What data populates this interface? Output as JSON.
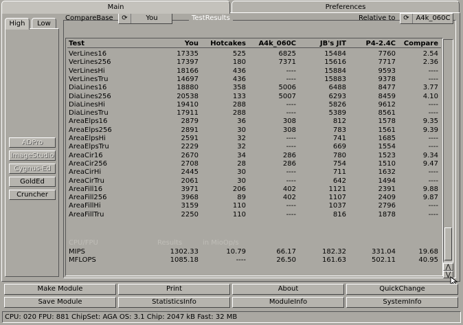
{
  "tabs": {
    "main": "Main",
    "preferences": "Preferences"
  },
  "subtabs": {
    "high": "High",
    "low": "Low"
  },
  "sidebar": {
    "buttons": [
      {
        "label": "ADPro",
        "enabled": false
      },
      {
        "label": "ImageStudio",
        "enabled": false
      },
      {
        "label": "Cygnus-Ed",
        "enabled": false
      },
      {
        "label": "GoldEd",
        "enabled": true
      },
      {
        "label": "Cruncher",
        "enabled": true
      }
    ]
  },
  "results": {
    "group_title": "TestResults",
    "compare_base_label": "CompareBase",
    "compare_base_value": "You",
    "relative_to_label": "Relative to",
    "relative_to_value": "A4k_060C",
    "headers": [
      "Test",
      "You",
      "Hotcakes",
      "A4k_060C",
      "JB's JIT",
      "P4-2.4C",
      "Compare"
    ],
    "rows": [
      [
        "VerLines16",
        "17335",
        "525",
        "6825",
        "15484",
        "7760",
        "2.54"
      ],
      [
        "VerLines256",
        "17397",
        "180",
        "7371",
        "15616",
        "7717",
        "2.36"
      ],
      [
        "VerLinesHi",
        "18166",
        "436",
        "----",
        "15884",
        "9593",
        "----"
      ],
      [
        "VerLinesTru",
        "14697",
        "436",
        "----",
        "15883",
        "9378",
        "----"
      ],
      [
        "DiaLines16",
        "18880",
        "358",
        "5006",
        "6488",
        "8477",
        "3.77"
      ],
      [
        "DiaLines256",
        "20538",
        "133",
        "5007",
        "6293",
        "8459",
        "4.10"
      ],
      [
        "DiaLinesHi",
        "19410",
        "288",
        "----",
        "5826",
        "9612",
        "----"
      ],
      [
        "DiaLinesTru",
        "17911",
        "288",
        "----",
        "5389",
        "8561",
        "----"
      ],
      [
        "AreaElps16",
        "2879",
        "36",
        "308",
        "812",
        "1578",
        "9.35"
      ],
      [
        "AreaElps256",
        "2891",
        "30",
        "308",
        "783",
        "1561",
        "9.39"
      ],
      [
        "AreaElpsHi",
        "2591",
        "32",
        "----",
        "741",
        "1685",
        "----"
      ],
      [
        "AreaElpsTru",
        "2229",
        "32",
        "----",
        "669",
        "1554",
        "----"
      ],
      [
        "AreaCir16",
        "2670",
        "34",
        "286",
        "780",
        "1523",
        "9.34"
      ],
      [
        "AreaCir256",
        "2708",
        "28",
        "286",
        "754",
        "1510",
        "9.47"
      ],
      [
        "AreaCirHi",
        "2445",
        "30",
        "----",
        "711",
        "1632",
        "----"
      ],
      [
        "AreaCirTru",
        "2061",
        "30",
        "----",
        "642",
        "1494",
        "----"
      ],
      [
        "AreaFill16",
        "3971",
        "206",
        "402",
        "1121",
        "2391",
        "9.88"
      ],
      [
        "AreaFill256",
        "3968",
        "89",
        "402",
        "1107",
        "2409",
        "9.87"
      ],
      [
        "AreaFillHi",
        "3159",
        "110",
        "----",
        "1037",
        "2796",
        "----"
      ],
      [
        "AreaFillTru",
        "2250",
        "110",
        "----",
        "816",
        "1878",
        "----"
      ]
    ],
    "section_header": [
      "CPU/FPU",
      "Results",
      "in MioOp/s"
    ],
    "cpu_rows": [
      [
        "MIPS",
        "1302.33",
        "10.79",
        "66.17",
        "182.32",
        "331.04",
        "19.68"
      ],
      [
        "MFLOPS",
        "1085.18",
        "----",
        "26.50",
        "161.63",
        "502.11",
        "40.95"
      ]
    ]
  },
  "scroll": {
    "up": "⋀",
    "down": "⋁"
  },
  "bottom_buttons": [
    [
      "Make Module",
      "Print",
      "About",
      "QuickChange"
    ],
    [
      "Save Module",
      "StatisticsInfo",
      "ModuleInfo",
      "SystemInfo"
    ]
  ],
  "status": "CPU: 020  FPU: 881  ChipSet: AGA  OS: 3.1  Chip: 2047 kB  Fast: 32 MB"
}
